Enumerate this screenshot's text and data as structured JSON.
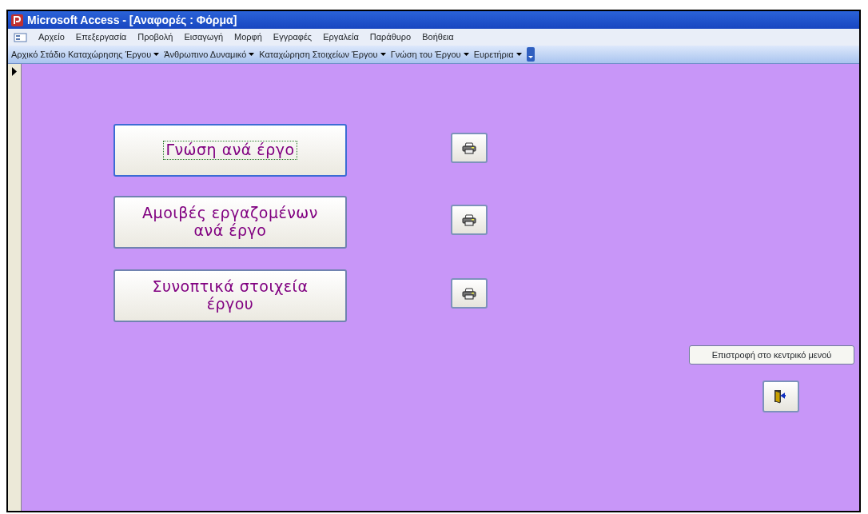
{
  "window": {
    "title": "Microsoft Access - [Αναφορές : Φόρμα]"
  },
  "menu": [
    "Αρχείο",
    "Επεξεργασία",
    "Προβολή",
    "Εισαγωγή",
    "Μορφή",
    "Εγγραφές",
    "Εργαλεία",
    "Παράθυρο",
    "Βοήθεια"
  ],
  "toolbar": [
    "Αρχικό Στάδιο Καταχώρησης Έργου",
    "Άνθρωπινο Δυναμικό",
    "Καταχώρηση Στοιχείων Έργου",
    "Γνώση του Έργου",
    "Ευρετήρια"
  ],
  "reports": [
    {
      "label": "Γνώση ανά έργο",
      "focused": true
    },
    {
      "label": "Αμοιβές εργαζομένων ανά έργο",
      "focused": false
    },
    {
      "label": "Συνοπτικά στοιχεία έργου",
      "focused": false
    }
  ],
  "return": {
    "label": "Επιστροφή στο κεντρικό μενού"
  }
}
